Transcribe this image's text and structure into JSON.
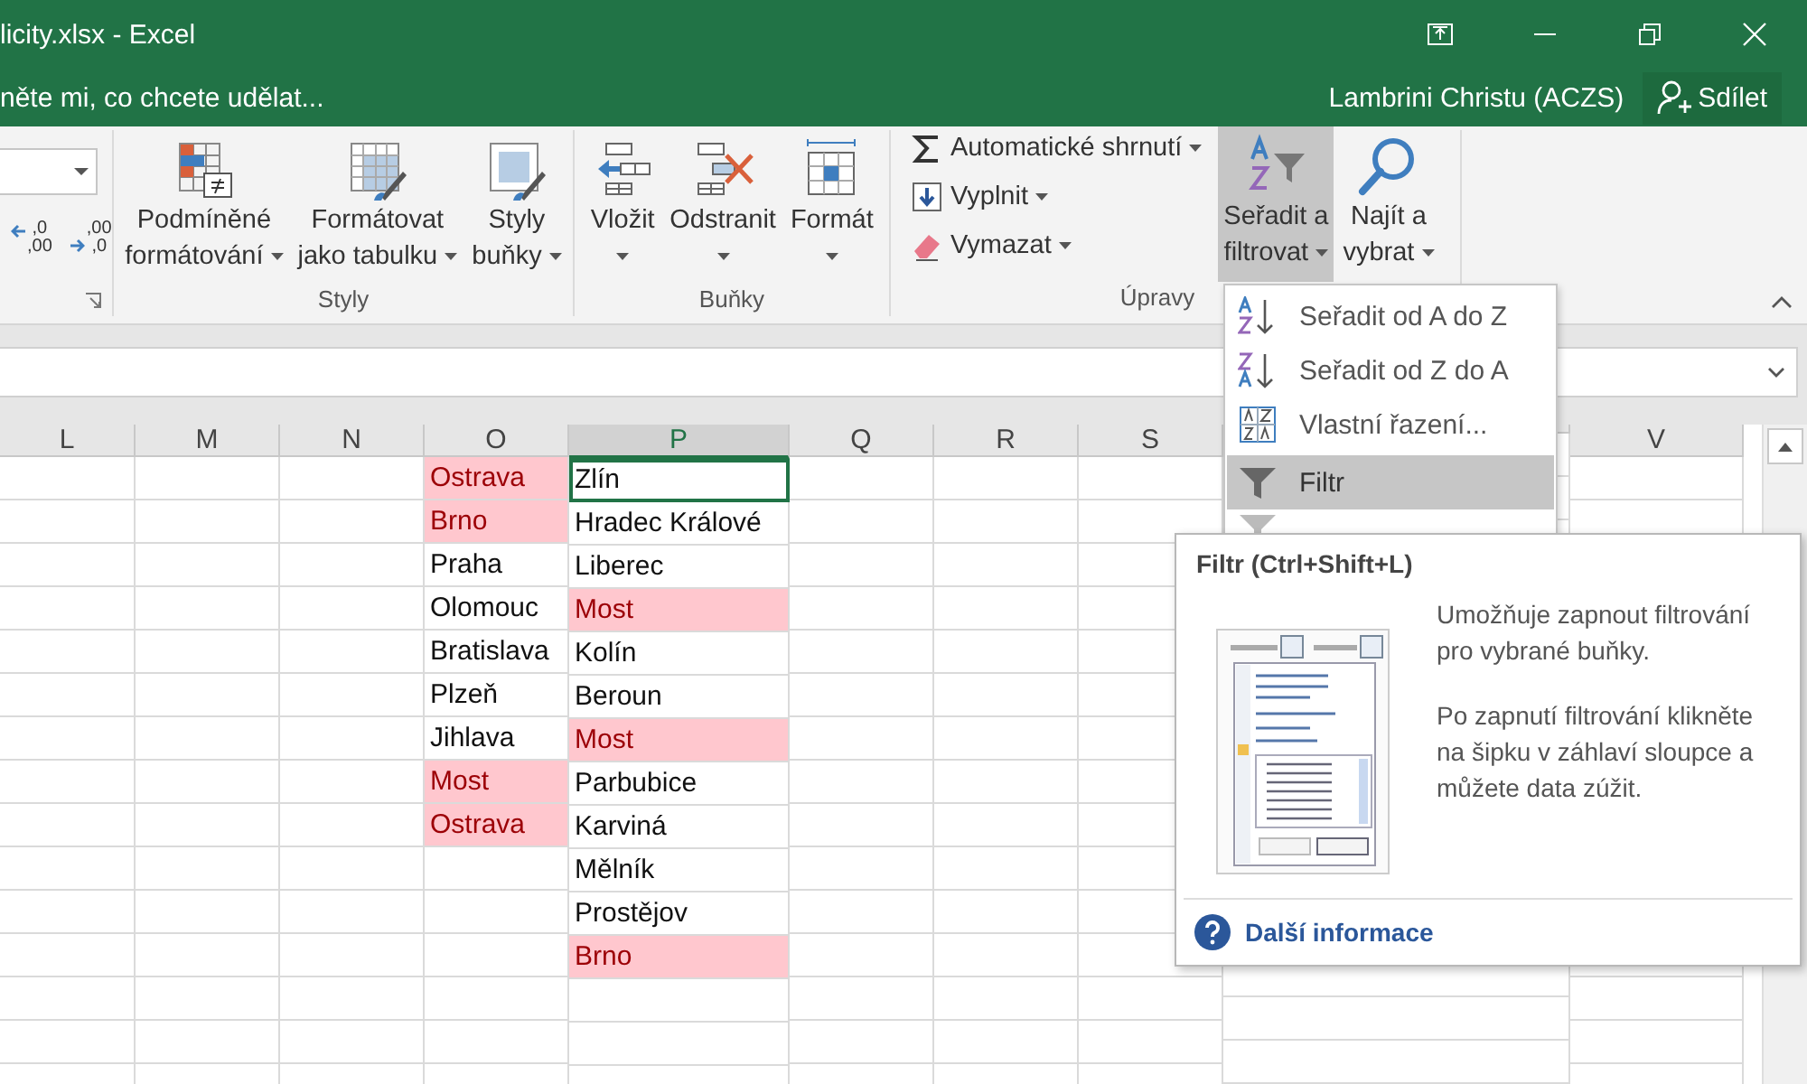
{
  "window": {
    "title": "licity.xlsx - Excel"
  },
  "tell_me": {
    "placeholder": "něte mi, co chcete udělat..."
  },
  "account": {
    "user": "Lambrini Christu (ACZS)",
    "share": "Sdílet"
  },
  "ribbon": {
    "number": {
      "decimals": [
        {
          "kind": "decrease",
          "top": ",0",
          "bottom": ",00"
        },
        {
          "kind": "increase",
          "top": ",00",
          "bottom": ",0"
        }
      ]
    },
    "styles": {
      "label": "Styly",
      "buttons": [
        {
          "kind": "conditional",
          "lines": [
            "Podmíněné",
            "formátování"
          ],
          "selected": false
        },
        {
          "kind": "table",
          "lines": [
            "Formátovat",
            "jako tabulku"
          ],
          "selected": false
        },
        {
          "kind": "cellstyles",
          "lines": [
            "Styly",
            "buňky"
          ],
          "selected": false
        }
      ]
    },
    "cells": {
      "label": "Buňky",
      "buttons": [
        {
          "kind": "insert",
          "lines": [
            "Vložit"
          ],
          "selected": false
        },
        {
          "kind": "delete",
          "lines": [
            "Odstranit"
          ],
          "selected": false
        },
        {
          "kind": "format",
          "lines": [
            "Formát"
          ],
          "selected": false
        }
      ]
    },
    "editing": {
      "label": "Úpravy",
      "small": [
        {
          "kind": "sum",
          "label": "Automatické shrnutí"
        },
        {
          "kind": "fill",
          "label": "Vyplnit"
        },
        {
          "kind": "clear",
          "label": "Vymazat"
        }
      ],
      "buttons": [
        {
          "kind": "sort",
          "lines": [
            "Seřadit a",
            "filtrovat"
          ],
          "selected": true
        },
        {
          "kind": "find",
          "lines": [
            "Najít a",
            "vybrat"
          ],
          "selected": false
        }
      ]
    }
  },
  "menu": {
    "items": [
      {
        "kind": "sort-az",
        "label": "Seřadit od A do Z",
        "selected": false
      },
      {
        "kind": "sort-za",
        "label": "Seřadit od Z do A",
        "selected": false
      },
      {
        "kind": "custom",
        "label": "Vlastní řazení...",
        "selected": false
      },
      {
        "kind": "filter",
        "label": "Filtr",
        "selected": true
      }
    ]
  },
  "tooltip": {
    "title": "Filtr (Ctrl+Shift+L)",
    "paragraphs": [
      "Umožňuje zapnout filtrování pro vybrané buňky.",
      "Po zapnutí filtrování klikněte na šipku v záhlaví sloupce a můžete data zúžit."
    ],
    "link": "Další informace"
  },
  "sheet": {
    "columns": [
      {
        "label": "L",
        "selected": false
      },
      {
        "label": "M",
        "selected": false
      },
      {
        "label": "N",
        "selected": false
      },
      {
        "label": "O",
        "selected": false,
        "cells": [
          {
            "text": "Ostrava",
            "highlight": true,
            "selected": false
          },
          {
            "text": "Brno",
            "highlight": true,
            "selected": false
          },
          {
            "text": "Praha",
            "highlight": false,
            "selected": false
          },
          {
            "text": "Olomouc",
            "highlight": false,
            "selected": false
          },
          {
            "text": "Bratislava",
            "highlight": false,
            "selected": false
          },
          {
            "text": "Plzeň",
            "highlight": false,
            "selected": false
          },
          {
            "text": "Jihlava",
            "highlight": false,
            "selected": false
          },
          {
            "text": "Most",
            "highlight": true,
            "selected": false
          },
          {
            "text": "Ostrava",
            "highlight": true,
            "selected": false
          }
        ]
      },
      {
        "label": "P",
        "selected": true,
        "cells": [
          {
            "text": "Zlín",
            "highlight": false,
            "selected": true
          },
          {
            "text": "Hradec Králové",
            "highlight": false,
            "selected": false
          },
          {
            "text": "Liberec",
            "highlight": false,
            "selected": false
          },
          {
            "text": "Most",
            "highlight": true,
            "selected": false
          },
          {
            "text": "Kolín",
            "highlight": false,
            "selected": false
          },
          {
            "text": "Beroun",
            "highlight": false,
            "selected": false
          },
          {
            "text": "Most",
            "highlight": true,
            "selected": false
          },
          {
            "text": "Parbubice",
            "highlight": false,
            "selected": false
          },
          {
            "text": "Karviná",
            "highlight": false,
            "selected": false
          },
          {
            "text": "Mělník",
            "highlight": false,
            "selected": false
          },
          {
            "text": "Prostějov",
            "highlight": false,
            "selected": false
          },
          {
            "text": "Brno",
            "highlight": true,
            "selected": false
          }
        ]
      },
      {
        "label": "Q",
        "selected": false
      },
      {
        "label": "R",
        "selected": false
      },
      {
        "label": "S",
        "selected": false
      },
      {
        "label": "V",
        "selected": false
      }
    ]
  }
}
